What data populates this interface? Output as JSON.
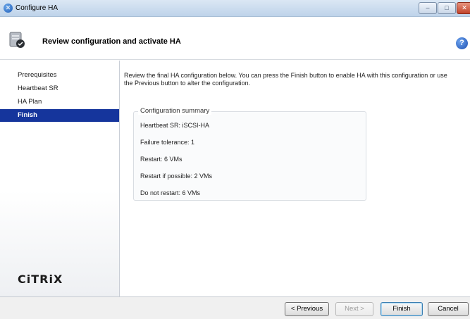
{
  "window": {
    "title": "Configure HA"
  },
  "header": {
    "title": "Review configuration and activate HA"
  },
  "sidebar": {
    "items": [
      {
        "label": "Prerequisites",
        "active": false
      },
      {
        "label": "Heartbeat SR",
        "active": false
      },
      {
        "label": "HA Plan",
        "active": false
      },
      {
        "label": "Finish",
        "active": true
      }
    ],
    "logo_text": "CiTRiX"
  },
  "main": {
    "intro": "Review the final HA configuration below. You can press the Finish button to enable HA with this configuration or use the Previous button to alter the configuration.",
    "summary": {
      "title": "Configuration summary",
      "lines": [
        "Heartbeat SR:  iSCSI-HA",
        "Failure tolerance:  1",
        "Restart:  6 VMs",
        "Restart if possible:  2 VMs",
        "Do not restart:  6 VMs"
      ]
    }
  },
  "footer": {
    "previous_label": "< Previous",
    "next_label": "Next >",
    "finish_label": "Finish",
    "cancel_label": "Cancel"
  },
  "colors": {
    "accent": "#15359c",
    "titlebar": "#c9dbef"
  },
  "icons": {
    "app": "xencenter-icon",
    "header": "ha-server-icon",
    "help": "help-icon"
  }
}
